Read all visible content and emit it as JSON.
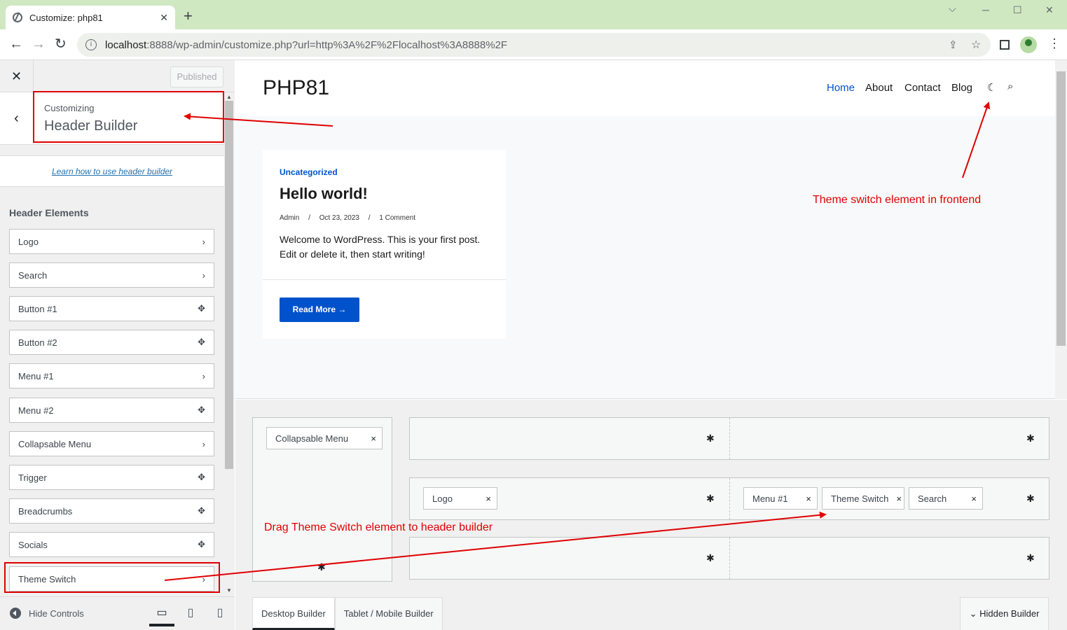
{
  "browser": {
    "tab_title": "Customize: php81",
    "new_tab": "+",
    "url_host": "localhost",
    "url_rest": ":8888/wp-admin/customize.php?url=http%3A%2F%2Flocalhost%3A8888%2F",
    "controls": {
      "minimize": "─",
      "maximize": "☐",
      "close": "✕",
      "collapse": "⌵"
    }
  },
  "sidebar": {
    "close": "✕",
    "published_label": "Published",
    "customizing": "Customizing",
    "panel_title": "Header Builder",
    "learn_link": "Learn how to use header builder",
    "section_title": "Header Elements",
    "items": [
      {
        "label": "Logo",
        "icon": "›"
      },
      {
        "label": "Search",
        "icon": "›"
      },
      {
        "label": "Button #1",
        "icon": "✥"
      },
      {
        "label": "Button #2",
        "icon": "✥"
      },
      {
        "label": "Menu #1",
        "icon": "›"
      },
      {
        "label": "Menu #2",
        "icon": "✥"
      },
      {
        "label": "Collapsable Menu",
        "icon": "›"
      },
      {
        "label": "Trigger",
        "icon": "✥"
      },
      {
        "label": "Breadcrumbs",
        "icon": "✥"
      },
      {
        "label": "Socials",
        "icon": "✥"
      },
      {
        "label": "Theme Switch",
        "icon": "›"
      }
    ],
    "hide_controls": "Hide Controls"
  },
  "preview": {
    "site_title": "PHP81",
    "nav": [
      "Home",
      "About",
      "Contact",
      "Blog"
    ],
    "post": {
      "category": "Uncategorized",
      "title": "Hello world!",
      "author": "Admin",
      "date": "Oct 23, 2023",
      "comments": "1 Comment",
      "sep": "/",
      "excerpt": "Welcome to WordPress. This is your first post. Edit or delete it, then start writing!",
      "read_more": "Read More"
    }
  },
  "builder": {
    "offcanvas_chip": "Collapsable Menu",
    "row_middle_left": [
      "Logo"
    ],
    "row_middle_right": [
      "Menu #1",
      "Theme Switch",
      "Search"
    ],
    "remove": "×",
    "tabs": [
      "Desktop Builder",
      "Tablet / Mobile Builder"
    ],
    "hidden_builder": "Hidden Builder"
  },
  "annotations": {
    "frontend": "Theme switch element in frontend",
    "drag": "Drag Theme Switch element to header builder",
    "color": "#e00000"
  }
}
